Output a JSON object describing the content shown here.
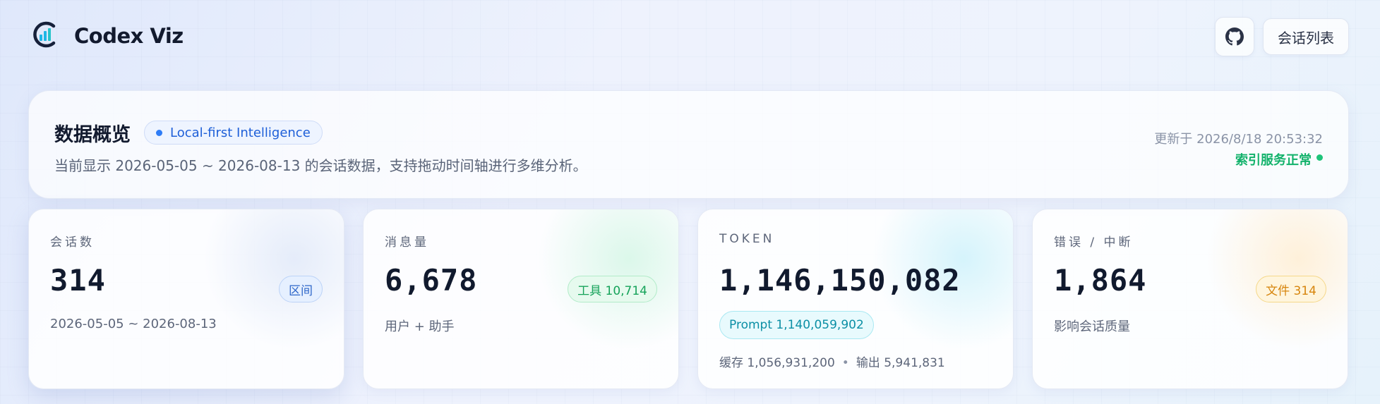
{
  "header": {
    "brand": "Codex Viz",
    "list_button": "会话列表",
    "logo_icon": "codex-logo-icon",
    "github_icon": "github-icon"
  },
  "overview": {
    "title": "数据概览",
    "pill": "Local-first Intelligence",
    "description": "当前显示 2026-05-05 ~ 2026-08-13 的会话数据，支持拖动时间轴进行多维分析。",
    "updated": "更新于 2026/8/18 20:53:32",
    "status": "索引服务正常"
  },
  "cards": {
    "sessions": {
      "label": "会话数",
      "value": "314",
      "badge": "区间",
      "sub": "2026-05-05 ~ 2026-08-13"
    },
    "messages": {
      "label": "消息量",
      "value": "6,678",
      "badge": "工具 10,714",
      "sub": "用户 + 助手"
    },
    "tokens": {
      "label": "TOKEN",
      "value": "1,146,150,082",
      "prompt": "Prompt 1,140,059,902",
      "cache": "缓存 1,056,931,200",
      "output": "输出 5,941,831",
      "separator": "•"
    },
    "errors": {
      "label": "错误 / 中断",
      "value": "1,864",
      "badge": "文件 314",
      "sub": "影响会话质量"
    }
  },
  "colors": {
    "accent": "#2e7cf6",
    "status_ok": "#12b26b",
    "text_primary": "#111a2e"
  }
}
